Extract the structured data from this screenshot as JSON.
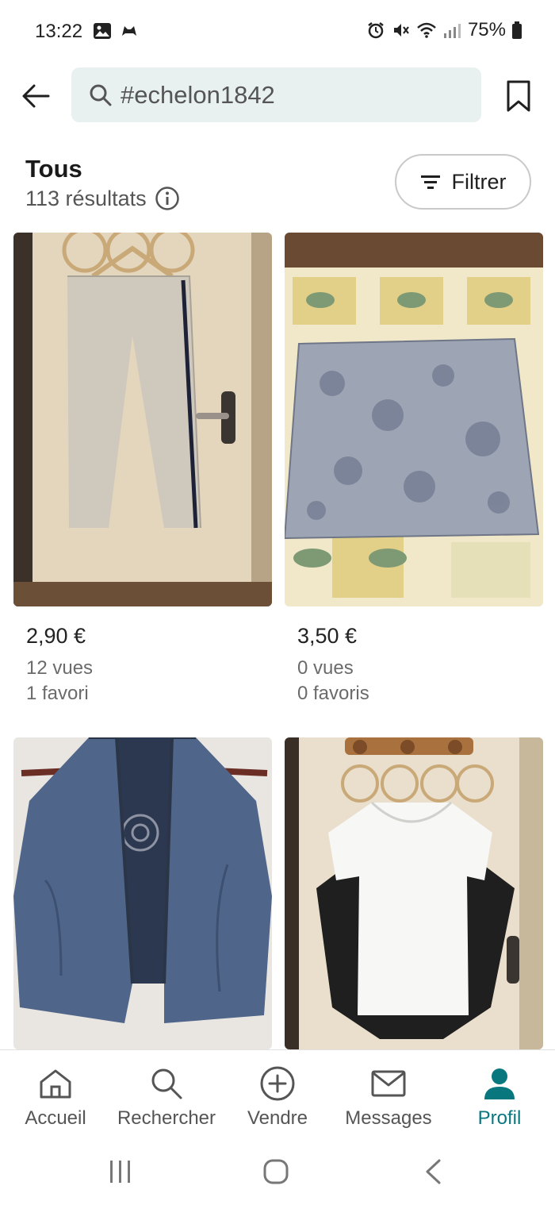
{
  "status_bar": {
    "time": "13:22",
    "battery": "75%"
  },
  "search": {
    "query": "#echelon1842",
    "placeholder": ""
  },
  "results": {
    "title": "Tous",
    "count": "113 résultats",
    "filter_label": "Filtrer"
  },
  "items": [
    {
      "price": "2,90 €",
      "views": "12 vues",
      "favorites": "1 favori"
    },
    {
      "price": "3,50 €",
      "views": "0 vues",
      "favorites": "0 favoris"
    },
    {
      "price": "",
      "views": "",
      "favorites": ""
    },
    {
      "price": "",
      "views": "",
      "favorites": ""
    }
  ],
  "bottom_nav": {
    "items": [
      {
        "label": "Accueil",
        "icon": "home-icon"
      },
      {
        "label": "Rechercher",
        "icon": "search-icon"
      },
      {
        "label": "Vendre",
        "icon": "plus-circle-icon"
      },
      {
        "label": "Messages",
        "icon": "mail-icon"
      },
      {
        "label": "Profil",
        "icon": "profile-icon",
        "active": true
      }
    ]
  },
  "colors": {
    "accent": "#09777e",
    "search_bg": "#e8f0f0"
  }
}
